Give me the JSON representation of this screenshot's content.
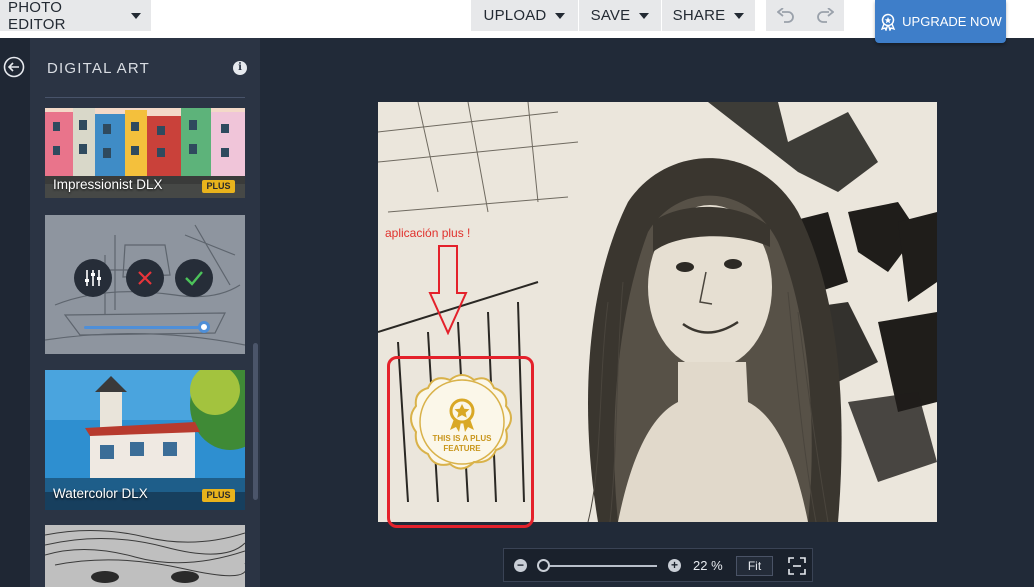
{
  "topbar": {
    "photo_editor_label": "PHOTO EDITOR",
    "upload_label": "UPLOAD",
    "save_label": "SAVE",
    "share_label": "SHARE",
    "upgrade_label": "UPGRADE NOW"
  },
  "panel": {
    "title": "DIGITAL ART",
    "effects": [
      {
        "label": "Impressionist DLX",
        "badge": "PLUS"
      },
      {
        "label": "",
        "slider_value": 1.0
      },
      {
        "label": "Watercolor DLX",
        "badge": "PLUS"
      },
      {
        "label": ""
      }
    ]
  },
  "canvas": {
    "annotation_text": "aplicación plus !",
    "seal_line1": "THIS IS A PLUS",
    "seal_line2": "FEATURE"
  },
  "zoom": {
    "percent": "22 %",
    "fit_label": "Fit",
    "level": 0.22
  },
  "colors": {
    "accent": "#3e7ec9",
    "plus_badge": "#e9b31c",
    "annotation": "#e4212b",
    "panel_bg": "#2b3444",
    "workspace_bg": "#212a38"
  }
}
